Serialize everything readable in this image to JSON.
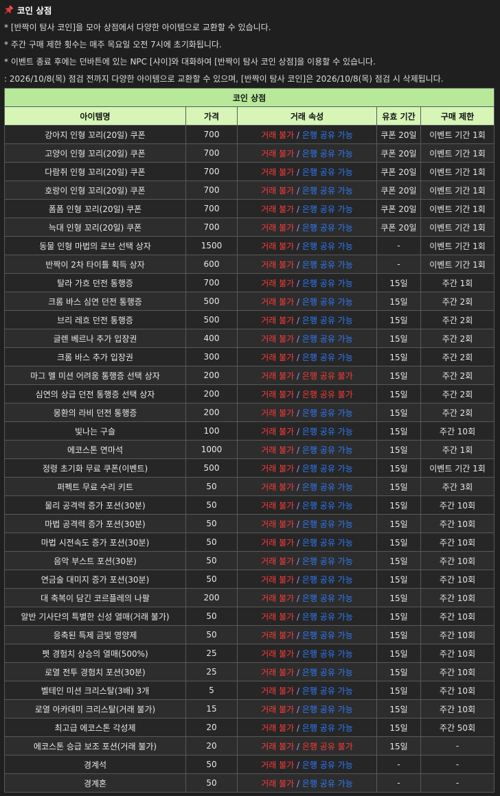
{
  "header": {
    "title": "코인 상점",
    "icon": "pushpin-icon",
    "accent": "#e53935"
  },
  "notes": [
    "* [반짝이 탐사 코인]을 모아 상점에서 다양한 아이템으로 교환할 수 있습니다.",
    "* 주간 구매 제한 횟수는 매주 목요일 오전 7시에 초기화됩니다.",
    "* 이벤트 종료 후에는 던바튼에 있는 NPC [샤이]와 대화하여 [반짝이 탐사 코인 상점]을 이용할 수 있습니다.",
    ": 2026/10/8(목) 점검 전까지 다양한 아이템으로 교환할 수 있으며, [반짝이 탐사 코인]은 2026/10/8(목) 점검 시 삭제됩니다."
  ],
  "table": {
    "caption": "코인 상점",
    "columns": [
      "아이템명",
      "가격",
      "거래 속성",
      "유효 기간",
      "구매 제한"
    ],
    "trade_label": "거래 불가",
    "slash": " / ",
    "bank_ok_label": "은행 공유 가능",
    "bank_no_label": "은행 공유 불가",
    "colors": {
      "header_bg": "#d6f5b7",
      "caption_bg": "#b8e99a",
      "trade_no": "#ff3b3b",
      "bank_ok": "#2e7dff"
    },
    "rows": [
      {
        "name": "강아지 인형 꼬리(20일) 쿠폰",
        "price": "700",
        "bank_ok": true,
        "period": "쿠폰 20일",
        "limit": "이벤트 기간 1회"
      },
      {
        "name": "고양이 인형 꼬리(20일) 쿠폰",
        "price": "700",
        "bank_ok": true,
        "period": "쿠폰 20일",
        "limit": "이벤트 기간 1회"
      },
      {
        "name": "다람쥐 인형 꼬리(20일) 쿠폰",
        "price": "700",
        "bank_ok": true,
        "period": "쿠폰 20일",
        "limit": "이벤트 기간 1회"
      },
      {
        "name": "호랑이 인형 꼬리(20일) 쿠폰",
        "price": "700",
        "bank_ok": true,
        "period": "쿠폰 20일",
        "limit": "이벤트 기간 1회"
      },
      {
        "name": "폼폼 인형 꼬리(20일) 쿠폰",
        "price": "700",
        "bank_ok": true,
        "period": "쿠폰 20일",
        "limit": "이벤트 기간 1회"
      },
      {
        "name": "늑대 인형 꼬리(20일) 쿠폰",
        "price": "700",
        "bank_ok": true,
        "period": "쿠폰 20일",
        "limit": "이벤트 기간 1회"
      },
      {
        "name": "동물 인형 마법의 로브 선택 상자",
        "price": "1500",
        "bank_ok": true,
        "period": "-",
        "limit": "이벤트 기간 1회"
      },
      {
        "name": "반짝이 2차 타이틀 획득 상자",
        "price": "600",
        "bank_ok": true,
        "period": "-",
        "limit": "이벤트 기간 1회"
      },
      {
        "name": "탈라 가흐 던전 통행증",
        "price": "700",
        "bank_ok": true,
        "period": "15일",
        "limit": "주간 1회"
      },
      {
        "name": "크롬 바스 심연 던전 통행증",
        "price": "500",
        "bank_ok": true,
        "period": "15일",
        "limit": "주간 2회"
      },
      {
        "name": "브리 레흐 던전 통행증",
        "price": "500",
        "bank_ok": true,
        "period": "15일",
        "limit": "주간 2회"
      },
      {
        "name": "글렌 베르나 추가 입장권",
        "price": "400",
        "bank_ok": true,
        "period": "15일",
        "limit": "주간 2회"
      },
      {
        "name": "크롬 바스 추가 입장권",
        "price": "300",
        "bank_ok": true,
        "period": "15일",
        "limit": "주간 2회"
      },
      {
        "name": "마그 멜 미션 어려움 통행증 선택 상자",
        "price": "200",
        "bank_ok": false,
        "period": "15일",
        "limit": "주간 2회"
      },
      {
        "name": "심연의 상급 던전 통행증 선택 상자",
        "price": "200",
        "bank_ok": false,
        "period": "15일",
        "limit": "주간 2회"
      },
      {
        "name": "몽환의 라비 던전 통행증",
        "price": "200",
        "bank_ok": true,
        "period": "15일",
        "limit": "주간 2회"
      },
      {
        "name": "빛나는 구슬",
        "price": "100",
        "bank_ok": true,
        "period": "15일",
        "limit": "주간 10회"
      },
      {
        "name": "에코스톤 연마석",
        "price": "1000",
        "bank_ok": true,
        "period": "15일",
        "limit": "주간 1회"
      },
      {
        "name": "정령 초기화 무료 쿠폰(이벤트)",
        "price": "500",
        "bank_ok": true,
        "period": "15일",
        "limit": "이벤트 기간 1회"
      },
      {
        "name": "퍼펙트 무료 수리 키트",
        "price": "50",
        "bank_ok": true,
        "period": "15일",
        "limit": "주간 3회"
      },
      {
        "name": "물리 공격력 증가 포션(30분)",
        "price": "50",
        "bank_ok": true,
        "period": "15일",
        "limit": "주간 10회"
      },
      {
        "name": "마법 공격력 증가 포션(30분)",
        "price": "50",
        "bank_ok": true,
        "period": "15일",
        "limit": "주간 10회"
      },
      {
        "name": "마법 시전속도 증가 포션(30분)",
        "price": "50",
        "bank_ok": true,
        "period": "15일",
        "limit": "주간 10회"
      },
      {
        "name": "음악 부스트 포션(30분)",
        "price": "50",
        "bank_ok": true,
        "period": "15일",
        "limit": "주간 10회"
      },
      {
        "name": "연금술 대미지 증가 포션(30분)",
        "price": "50",
        "bank_ok": true,
        "period": "15일",
        "limit": "주간 10회"
      },
      {
        "name": "대 축복이 담긴 코르플레의 나팔",
        "price": "200",
        "bank_ok": true,
        "period": "15일",
        "limit": "주간 10회"
      },
      {
        "name": "알반 기사단의 특별한 신성 열매(거래 불가)",
        "price": "50",
        "bank_ok": true,
        "period": "15일",
        "limit": "주간 10회"
      },
      {
        "name": "응축된 특제 금빛 영양제",
        "price": "50",
        "bank_ok": true,
        "period": "15일",
        "limit": "주간 10회"
      },
      {
        "name": "펫 경험치 상승의 열매(500%)",
        "price": "25",
        "bank_ok": true,
        "period": "15일",
        "limit": "주간 10회"
      },
      {
        "name": "로열 전투 경험치 포션(30분)",
        "price": "25",
        "bank_ok": true,
        "period": "15일",
        "limit": "주간 10회"
      },
      {
        "name": "벨테인 미션 크리스탈(3배) 3개",
        "price": "5",
        "bank_ok": true,
        "period": "15일",
        "limit": "주간 10회"
      },
      {
        "name": "로열 아카데미 크리스탈(거래 불가)",
        "price": "15",
        "bank_ok": true,
        "period": "15일",
        "limit": "주간 10회"
      },
      {
        "name": "최고급 에코스톤 각성제",
        "price": "20",
        "bank_ok": true,
        "period": "15일",
        "limit": "주간 50회"
      },
      {
        "name": "에코스톤 승급 보조 포션(거래 불가)",
        "price": "20",
        "bank_ok": false,
        "period": "15일",
        "limit": "-"
      },
      {
        "name": "경계석",
        "price": "50",
        "bank_ok": true,
        "period": "-",
        "limit": "-"
      },
      {
        "name": "경계혼",
        "price": "50",
        "bank_ok": true,
        "period": "-",
        "limit": "-"
      }
    ]
  }
}
